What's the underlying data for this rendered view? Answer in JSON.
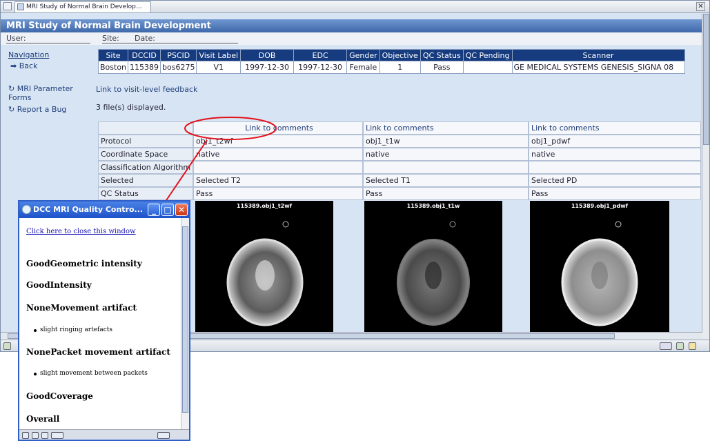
{
  "browser": {
    "tab_title": "MRI Study of Normal Brain Develop...",
    "close_glyph": "✕"
  },
  "header": {
    "title": "MRI Study of Normal Brain Development",
    "user_label": "User:",
    "site_label": "Site:",
    "date_label": "Date:"
  },
  "sidebar": {
    "navigation_label": "Navigation",
    "back": "Back",
    "mri_parameter_forms": "MRI Parameter Forms",
    "report_bug": "Report a Bug"
  },
  "visit_table": {
    "headers": [
      "Site",
      "DCCID",
      "PSCID",
      "Visit Label",
      "DOB",
      "EDC",
      "Gender",
      "Objective",
      "QC Status",
      "QC Pending",
      "Scanner"
    ],
    "row": [
      "Boston",
      "115389",
      "bos6275",
      "V1",
      "1997-12-30",
      "1997-12-30",
      "Female",
      "1",
      "Pass",
      "",
      "GE MEDICAL SYSTEMS GENESIS_SIGNA 08"
    ]
  },
  "visit_feedback_link": "Link to visit-level feedback",
  "files_displayed": "3 file(s) displayed.",
  "files": {
    "row_labels": [
      "",
      "Protocol",
      "Coordinate Space",
      "Classification Algorithm",
      "Selected",
      "QC Status"
    ],
    "columns": [
      {
        "comments_link": "Link to comments",
        "protocol": "obj1_t2wf",
        "coordinate_space": "native",
        "classification": "",
        "selected": "Selected T2",
        "qc_status": "Pass",
        "image_caption": "115389.obj1_t2wf"
      },
      {
        "comments_link": "Link to comments",
        "protocol": "obj1_t1w",
        "coordinate_space": "native",
        "classification": "",
        "selected": "Selected T1",
        "qc_status": "Pass",
        "image_caption": "115389.obj1_t1w"
      },
      {
        "comments_link": "Link to comments",
        "protocol": "obj1_pdwf",
        "coordinate_space": "native",
        "classification": "",
        "selected": "Selected PD",
        "qc_status": "Pass",
        "image_caption": "115389.obj1_pdwf"
      }
    ]
  },
  "popup": {
    "title": "DCC MRI Quality Contro...",
    "close_link": "Click here to close this window",
    "items": [
      {
        "heading": "GoodGeometric intensity",
        "bullets": []
      },
      {
        "heading": "GoodIntensity",
        "bullets": []
      },
      {
        "heading": "NoneMovement artifact",
        "bullets": [
          "slight ringing artefacts"
        ]
      },
      {
        "heading": "NonePacket movement artifact",
        "bullets": [
          "slight movement between packets"
        ]
      },
      {
        "heading": "GoodCoverage",
        "bullets": []
      },
      {
        "heading": "Overall",
        "bullets": []
      }
    ]
  },
  "colors": {
    "header_bar": "#3e68aa",
    "table_header": "#163c7f",
    "callout": "#e3101a",
    "popup_titlebar": "#1c52c8"
  }
}
